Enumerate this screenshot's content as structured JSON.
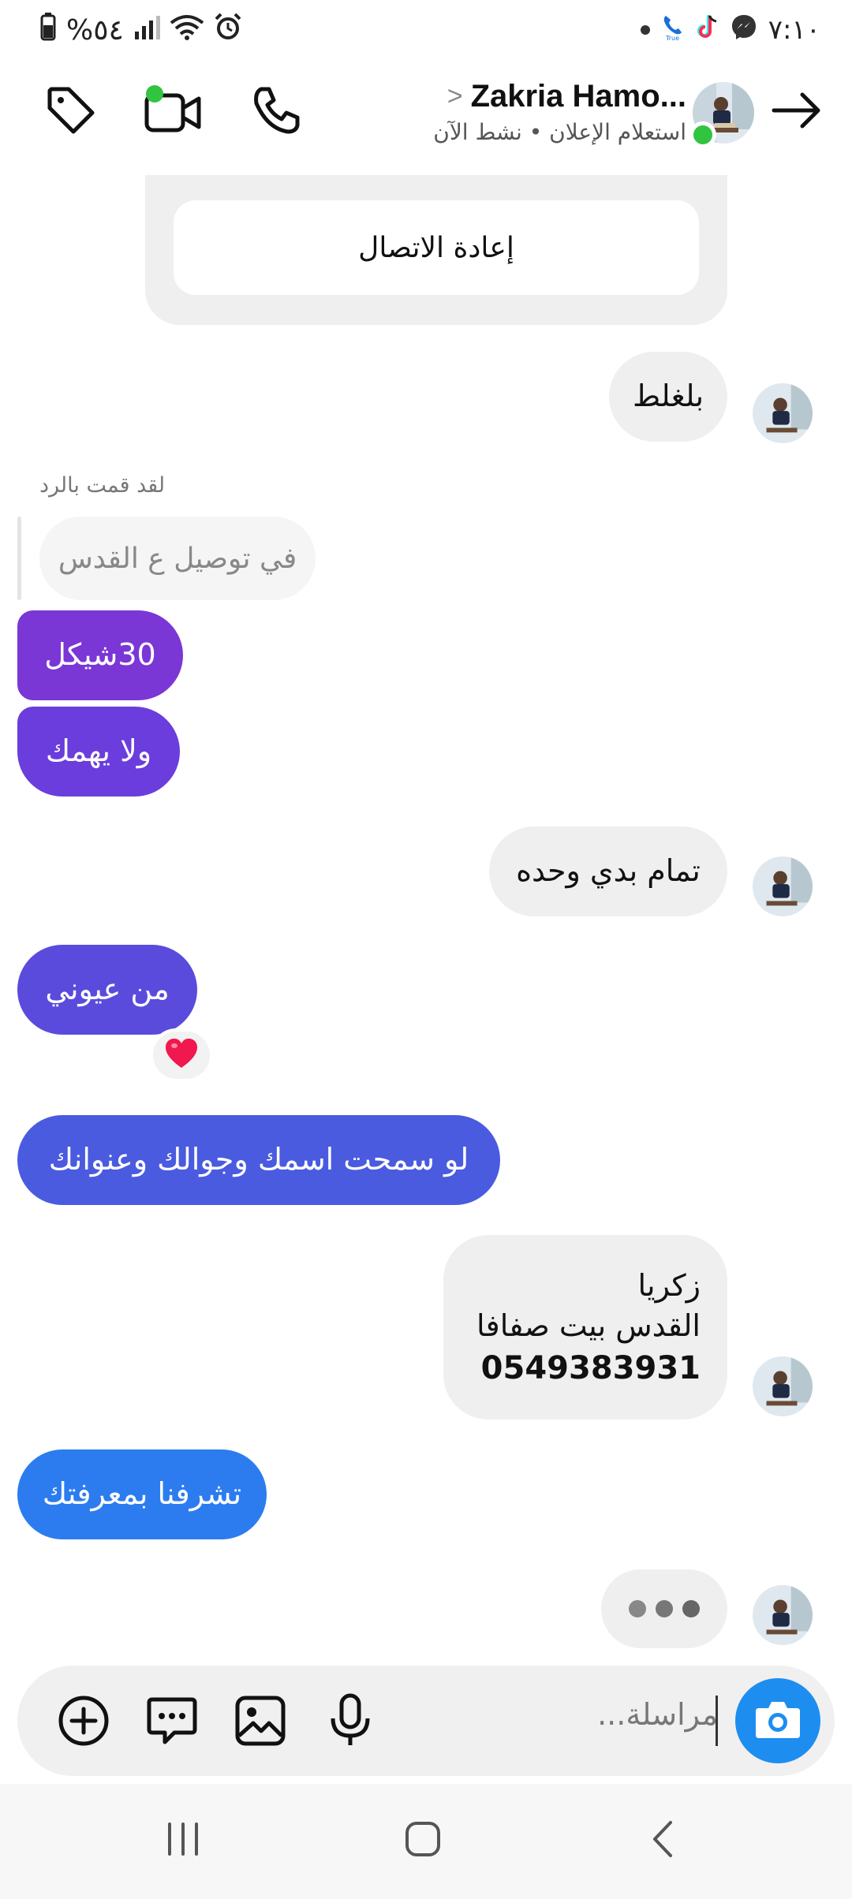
{
  "status_bar": {
    "time": "٧:١٠",
    "battery": "%٥٤",
    "signal": "lll"
  },
  "header": {
    "contact_name": "Zakria Hamo...",
    "subtitle": "استعلام الإعلان • نشط الآن"
  },
  "call_card": {
    "redial_label": "إعادة الاتصال"
  },
  "reply": {
    "label": "لقد قمت بالرد",
    "quoted_text": "في توصيل ع القدس"
  },
  "messages": [
    {
      "id": "m1",
      "from": "them",
      "text": "بلغلط"
    },
    {
      "id": "m2",
      "from": "me",
      "text": "30شيكل"
    },
    {
      "id": "m3",
      "from": "me",
      "text": "ولا يهمك"
    },
    {
      "id": "m4",
      "from": "them",
      "text": "تمام بدي وحده"
    },
    {
      "id": "m5",
      "from": "me",
      "text": "من عيوني"
    },
    {
      "id": "m6",
      "from": "me",
      "text": "لو سمحت اسمك وجوالك وعنوانك"
    },
    {
      "id": "m7",
      "from": "them",
      "lines": [
        "زكريا",
        "القدس بيت صفافا",
        "0549383931"
      ]
    },
    {
      "id": "m8",
      "from": "me",
      "text": "تشرفنا بمعرفتك"
    }
  ],
  "reaction": {
    "emoji_name": "heart",
    "color": "#f0184f"
  },
  "typing_indicator": "typing-dots",
  "composer": {
    "placeholder": "مراسلة..."
  },
  "colors": {
    "gradient_purple": "#7b36d6",
    "gradient_violet": "#6a3ddc",
    "gradient_indigo": "#4a5be0",
    "gradient_blue": "#2c7cf0",
    "camera_blue": "#1d8ef0",
    "online_green": "#31c440"
  }
}
